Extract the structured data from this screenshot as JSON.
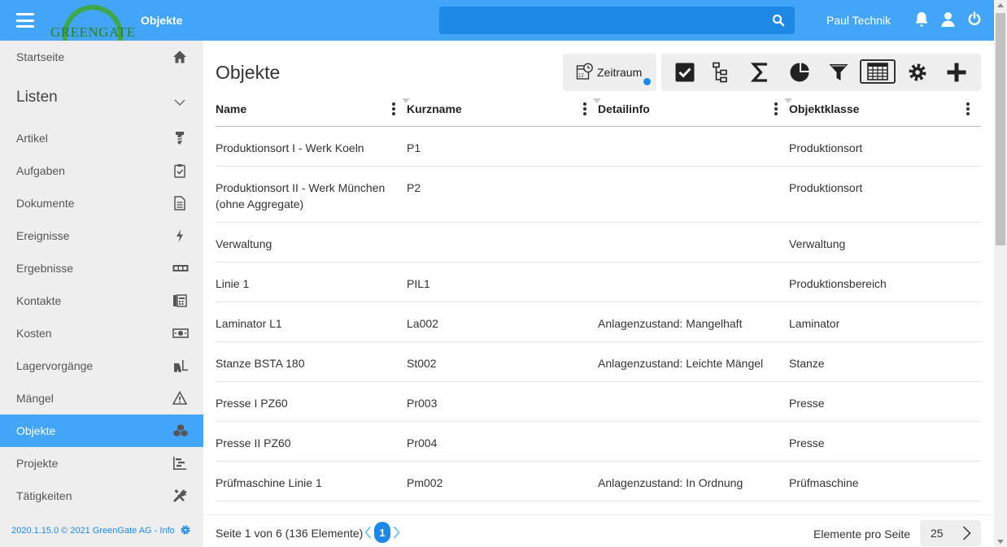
{
  "header": {
    "logo_text": "GREENGATE",
    "breadcrumb": "Objekte",
    "search_placeholder": "",
    "user_name": "Paul Technik",
    "icons": [
      "bell-icon",
      "user-icon",
      "power-icon"
    ]
  },
  "sidebar": {
    "home": {
      "label": "Startseite",
      "icon": "home-icon"
    },
    "group": {
      "label": "Listen",
      "icon": "chevron-down-icon"
    },
    "items": [
      {
        "label": "Artikel",
        "icon": "screw-icon"
      },
      {
        "label": "Aufgaben",
        "icon": "clipboard-check-icon"
      },
      {
        "label": "Dokumente",
        "icon": "document-icon"
      },
      {
        "label": "Ereignisse",
        "icon": "lightning-icon"
      },
      {
        "label": "Ergebnisse",
        "icon": "counter-icon"
      },
      {
        "label": "Kontakte",
        "icon": "address-book-icon"
      },
      {
        "label": "Kosten",
        "icon": "money-icon"
      },
      {
        "label": "Lagervorgänge",
        "icon": "forklift-icon"
      },
      {
        "label": "Mängel",
        "icon": "warning-icon"
      },
      {
        "label": "Objekte",
        "icon": "cubes-icon",
        "active": true
      },
      {
        "label": "Projekte",
        "icon": "gantt-icon"
      },
      {
        "label": "Tätigkeiten",
        "icon": "tools-icon"
      }
    ],
    "footer": "2020.1.15.0 © 2021 GreenGate AG - Info"
  },
  "main": {
    "title": "Objekte",
    "zeitraum_label": "Zeitraum",
    "toolbar": [
      "checkbox-icon",
      "tree-icon",
      "sigma-icon",
      "pie-chart-icon",
      "filter-icon",
      "table-icon",
      "gear-icon",
      "plus-icon"
    ]
  },
  "table": {
    "columns": [
      "Name",
      "Kurzname",
      "Detailinfo",
      "Objektklasse"
    ],
    "rows": [
      {
        "name": "Produktionsort I - Werk Koeln",
        "kurz": "P1",
        "detail": "",
        "klasse": "Produktionsort"
      },
      {
        "name": "Produktionsort II - Werk München (ohne Aggregate)",
        "kurz": "P2",
        "detail": "",
        "klasse": "Produktionsort"
      },
      {
        "name": "Verwaltung",
        "kurz": "",
        "detail": "",
        "klasse": "Verwaltung"
      },
      {
        "name": "Linie 1",
        "kurz": "PIL1",
        "detail": "",
        "klasse": "Produktionsbereich"
      },
      {
        "name": "Laminator L1",
        "kurz": "La002",
        "detail": "Anlagenzustand: Mangelhaft",
        "klasse": "Laminator"
      },
      {
        "name": "Stanze BSTA 180",
        "kurz": "St002",
        "detail": "Anlagenzustand: Leichte Mängel",
        "klasse": "Stanze"
      },
      {
        "name": "Presse I PZ60",
        "kurz": "Pr003",
        "detail": "",
        "klasse": "Presse"
      },
      {
        "name": "Presse II PZ60",
        "kurz": "Pr004",
        "detail": "",
        "klasse": "Presse"
      },
      {
        "name": "Prüfmaschine Linie 1",
        "kurz": "Pm002",
        "detail": "Anlagenzustand: In Ordnung",
        "klasse": "Prüfmaschine"
      }
    ]
  },
  "pager": {
    "text": "Seite 1 von 6 (136 Elemente)",
    "current_page": "1",
    "per_page_label": "Elemente pro Seite",
    "per_page_value": "25"
  },
  "colors": {
    "primary": "#42a5f5",
    "accent": "#1e88e5",
    "sidebar_bg": "#eeeeee",
    "logo_green": "#3ea74a"
  }
}
